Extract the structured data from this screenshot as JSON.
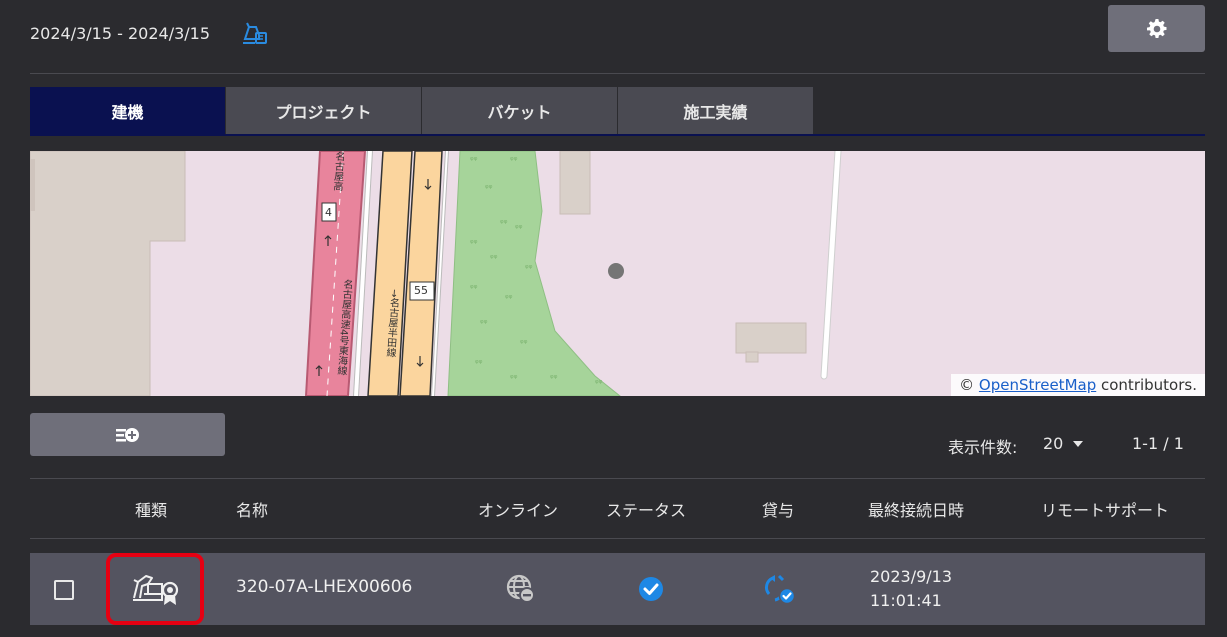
{
  "header": {
    "date_range": "2024/3/15 - 2024/3/15",
    "filter_icon": "machine-filter-icon",
    "settings_icon": "gear-icon"
  },
  "tabs": [
    {
      "label": "建機",
      "active": true
    },
    {
      "label": "プロジェクト",
      "active": false
    },
    {
      "label": "バケット",
      "active": false
    },
    {
      "label": "施工実績",
      "active": false
    }
  ],
  "map": {
    "attribution_prefix": "© ",
    "attribution_link": "OpenStreetMap",
    "attribution_suffix": " contributors.",
    "road_labels": {
      "route_4": "4",
      "route_55": "55",
      "expressway_upper": "名古屋高",
      "expressway_lower": "名古屋高速4号東海線",
      "handa_line": "→名古屋半田線"
    },
    "colors": {
      "land": "#ecdde7",
      "park": "#a6d49a",
      "expressway": "#e8849c",
      "trunk": "#fbd59e",
      "building": "#d9d0c9"
    }
  },
  "toolbar": {
    "add_list_icon": "list-add-icon",
    "per_page_label": "表示件数:",
    "per_page_value": "20",
    "page_range": "1-1 / 1"
  },
  "table": {
    "headers": {
      "type": "種類",
      "name": "名称",
      "online": "オンライン",
      "status": "ステータス",
      "lending": "貸与",
      "last_connection": "最終接続日時",
      "remote_support": "リモートサポート"
    },
    "rows": [
      {
        "checked": false,
        "type_icon": "excavator-certified-icon",
        "name": "320-07A-LHEX00606",
        "online_icon": "globe-offline-icon",
        "status_icon": "check-circle-icon",
        "lending_icon": "sync-check-icon",
        "last_connection_date": "2023/9/13",
        "last_connection_time": "11:01:41",
        "remote_support": ""
      }
    ]
  },
  "colors": {
    "background": "#2b2b2f",
    "active_tab": "#0a1150",
    "accent_blue": "#1e88e5",
    "highlight_red": "#e60012"
  }
}
